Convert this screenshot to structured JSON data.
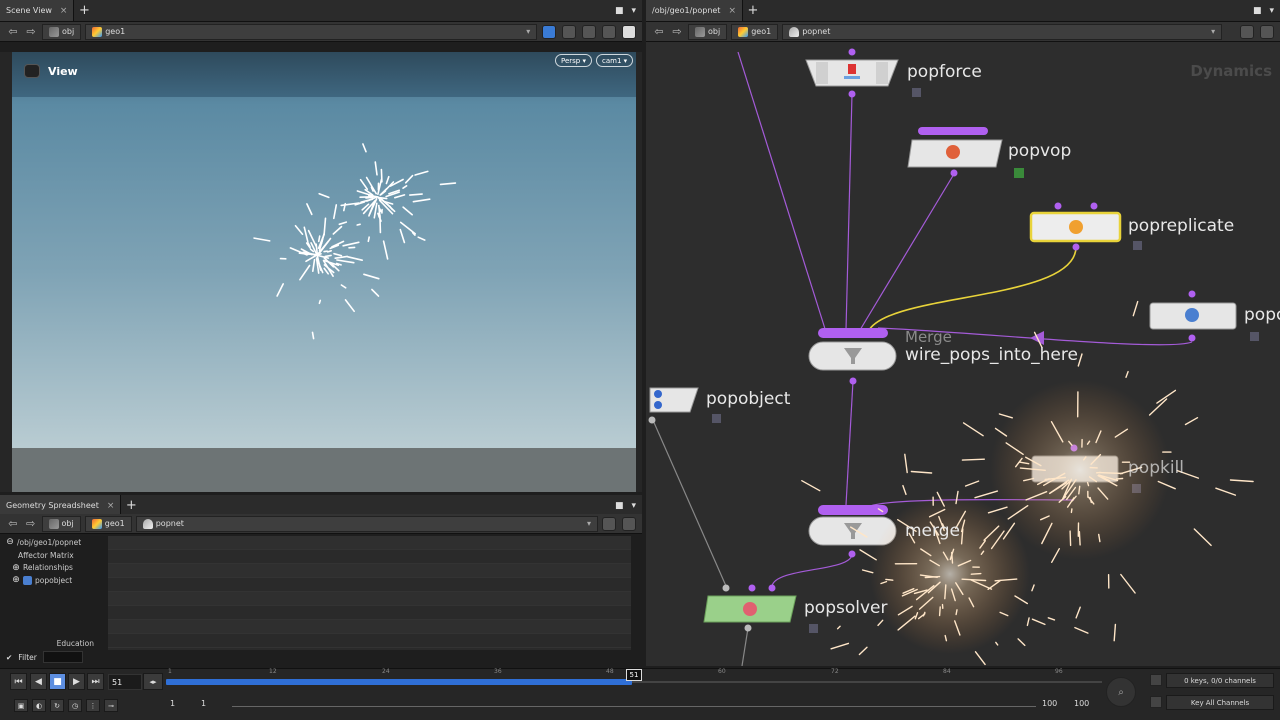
{
  "left_pane": {
    "tab_label": "Scene View",
    "path": [
      "obj",
      "geo1"
    ],
    "view_label": "View",
    "persp_label": "Persp ▾",
    "cam_label": "cam1 ▾"
  },
  "spreadsheet": {
    "tab_label": "Geometry Spreadsheet",
    "path": [
      "obj",
      "geo1",
      "popnet"
    ],
    "tree": [
      {
        "label": "/obj/geo1/popnet",
        "plus": "⊖"
      },
      {
        "label": "Affector Matrix",
        "plus": ""
      },
      {
        "label": "Relationships",
        "plus": "⊕"
      },
      {
        "label": "popobject",
        "plus": "⊕"
      }
    ],
    "education_label": "Education",
    "filter_label": "Filter"
  },
  "network": {
    "tab_label": "/obj/geo1/popnet",
    "path": [
      "obj",
      "geo1",
      "popnet"
    ],
    "context_title": "Dynamics",
    "nodes": {
      "popforce": "popforce",
      "popvop": "popvop",
      "popreplicate": "popreplicate",
      "popcut": "popc",
      "merge_top_sub": "Merge",
      "merge_top": "wire_pops_into_here",
      "popobject": "popobject",
      "popkill": "popkill",
      "merge_bottom": "merge",
      "popsolver": "popsolver"
    }
  },
  "timeline": {
    "current_frame": "51",
    "ticks": [
      "1",
      "12",
      "24",
      "36",
      "48",
      "60",
      "72",
      "84",
      "96"
    ],
    "start_a": "1",
    "start_b": "1",
    "end_a": "100",
    "end_b": "100",
    "keys_label": "0 keys, 0/0 channels",
    "key_all_label": "Key All Channels"
  }
}
